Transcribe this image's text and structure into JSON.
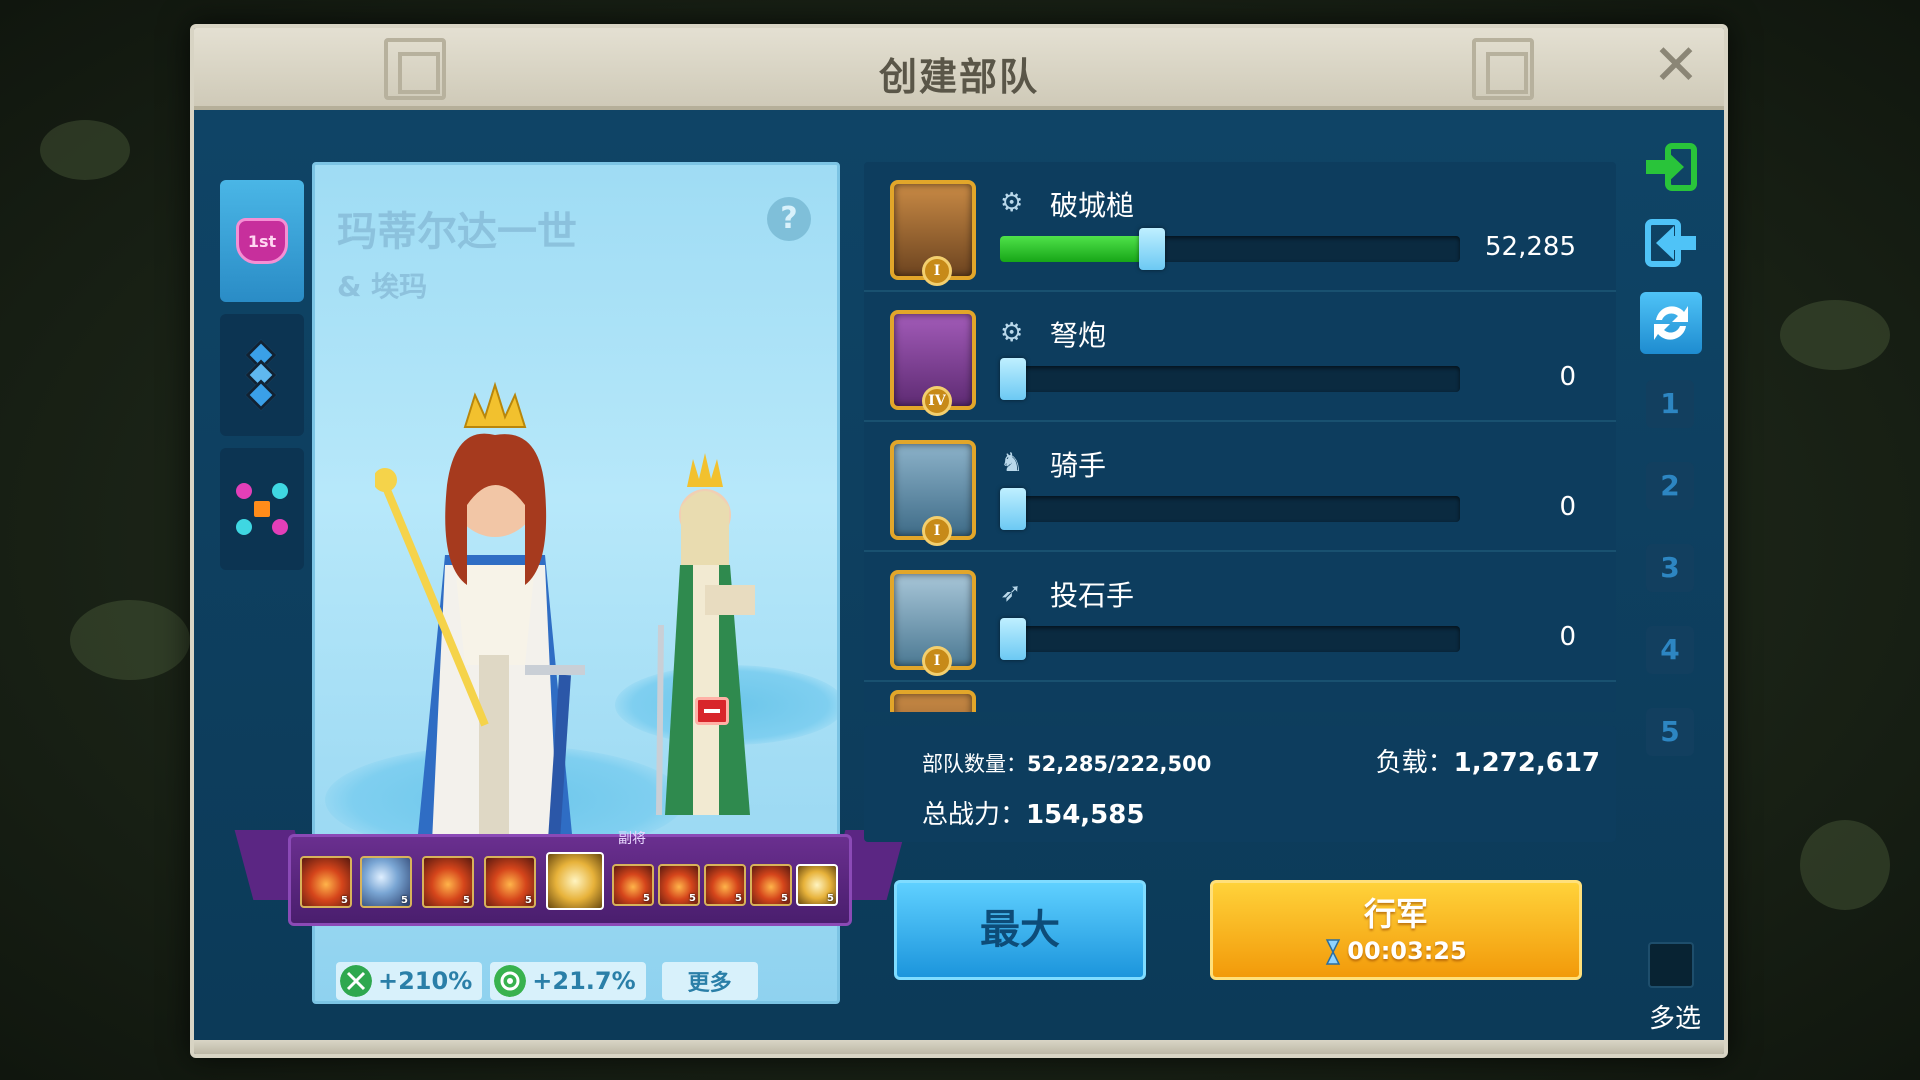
{
  "dialog": {
    "title": "创建部队",
    "close_label": "✕"
  },
  "left_tabs": [
    {
      "id": "commander",
      "icon": "crown-icon",
      "label": "1st"
    },
    {
      "id": "formation",
      "icon": "diamond-formation-icon"
    },
    {
      "id": "color-formation",
      "icon": "grid-formation-icon"
    }
  ],
  "commander": {
    "primary_name": "玛蒂尔达一世",
    "secondary_name": "& 埃玛",
    "help_label": "?",
    "secondary_label": "副将",
    "skill_levels": [
      "5",
      "5",
      "5",
      "5",
      "",
      "5",
      "5",
      "5",
      "5",
      "5"
    ]
  },
  "bonuses": [
    {
      "icon": "sword-icon",
      "value": "+210%",
      "color": "#2fa84f"
    },
    {
      "icon": "gear-icon",
      "value": "+21.7%",
      "color": "#38b24e"
    }
  ],
  "more_label": "更多",
  "troops": [
    {
      "name": "破城槌",
      "type_icon": "siege-icon",
      "tier": "I",
      "count": "52,285",
      "fill": 0.33
    },
    {
      "name": "弩炮",
      "type_icon": "siege-icon",
      "tier": "IV",
      "count": "0",
      "fill": 0
    },
    {
      "name": "骑手",
      "type_icon": "cavalry-icon",
      "tier": "I",
      "count": "0",
      "fill": 0
    },
    {
      "name": "投石手",
      "type_icon": "archer-icon",
      "tier": "I",
      "count": "0",
      "fill": 0
    }
  ],
  "stats": {
    "troop_count_label": "部队数量：",
    "troop_count_value": "52,285/222,500",
    "load_label": "负载：",
    "load_value": "1,272,617",
    "power_label": "总战力：",
    "power_value": "154,585"
  },
  "actions": {
    "max_label": "最大",
    "march_label": "行军",
    "march_time": "00:03:25"
  },
  "right_column": {
    "presets": [
      "1",
      "2",
      "3",
      "4",
      "5"
    ],
    "multi_select_label": "多选"
  },
  "colors": {
    "accent_blue": "#2a8cc6",
    "slider_green": "#17a617",
    "march_orange": "#f29a0a"
  }
}
